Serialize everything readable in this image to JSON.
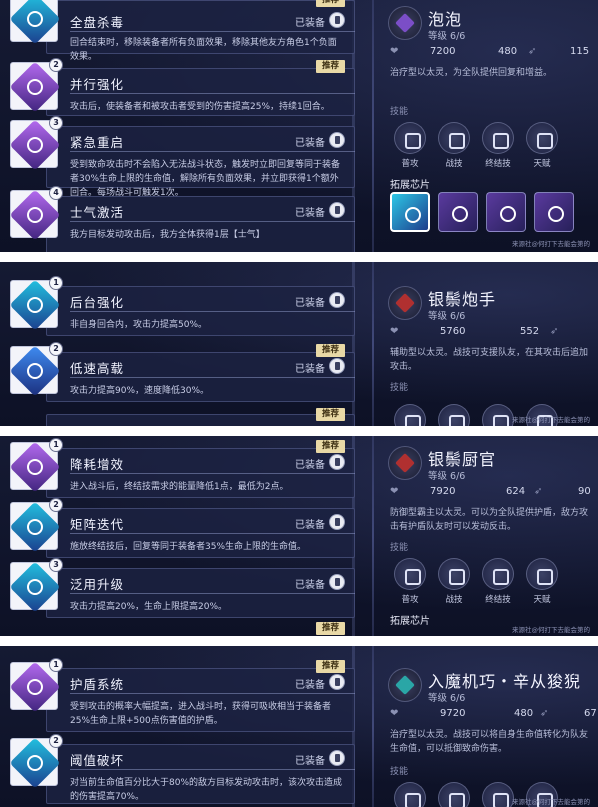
{
  "screens": [
    {
      "chips": [
        {
          "num": "",
          "name": "全盘杀毒",
          "equip": "已装备",
          "tag": "推荐",
          "desc": "回合结束时，移除装备者所有负面效果，移除其他友方角色1个负面效果。",
          "color": "teal"
        },
        {
          "num": "2",
          "name": "并行强化",
          "equip": "",
          "tag": "推荐",
          "desc": "攻击后，使装备者和被攻击者受到的伤害提高25%，持续1回合。",
          "color": "purple"
        },
        {
          "num": "3",
          "name": "紧急重启",
          "equip": "已装备",
          "tag": "",
          "desc": "受到致命攻击时不会陷入无法战斗状态，触发时立即回复等同于装备者30%生命上限的生命值，解除所有负面效果，并立即获得1个额外回合。每场战斗可触发1次。",
          "color": "purple"
        },
        {
          "num": "4",
          "name": "士气激活",
          "equip": "已装备",
          "tag": "",
          "desc": "我方目标发动攻击后，我方全体获得1层【士气】",
          "color": "purple"
        }
      ],
      "character": {
        "name": "泡泡",
        "level": "等级 6/6",
        "hp": "7200",
        "atk": "480",
        "third_stat": "115",
        "desc": "治疗型以太灵，为全队提供回复和增益。",
        "skills_title": "技能",
        "skills": [
          "普攻",
          "战技",
          "终结技",
          "天赋"
        ],
        "chips_title": "拓展芯片",
        "watermark": "来源社@何打下去能会第的"
      }
    },
    {
      "chips": [
        {
          "num": "1",
          "name": "后台强化",
          "equip": "已装备",
          "tag": "",
          "desc": "非自身回合内，攻击力提高50%。",
          "color": "teal"
        },
        {
          "num": "2",
          "name": "低速高载",
          "equip": "已装备",
          "tag": "推荐",
          "desc": "攻击力提高90%，速度降低30%。",
          "color": "blue"
        }
      ],
      "next_tag": "推荐",
      "character": {
        "name": "银鬃炮手",
        "level": "等级 6/6",
        "hp": "5760",
        "atk": "552",
        "desc": "辅助型以太灵。战技可支援队友，在其攻击后追加攻击。",
        "skills_title": "技能",
        "watermark": "来源社@何打下去能会第的"
      }
    },
    {
      "chips": [
        {
          "num": "1",
          "name": "降耗增效",
          "equip": "已装备",
          "tag": "推荐",
          "desc": "进入战斗后，终结技需求的能量降低1点，最低为2点。",
          "color": "purple"
        },
        {
          "num": "2",
          "name": "矩阵迭代",
          "equip": "已装备",
          "tag": "",
          "desc": "施放终结技后，回复等同于装备者35%生命上限的生命值。",
          "color": "teal"
        },
        {
          "num": "3",
          "name": "泛用升级",
          "equip": "已装备",
          "tag": "",
          "desc": "攻击力提高20%，生命上限提高20%。",
          "color": "teal"
        }
      ],
      "next_tag": "推荐",
      "character": {
        "name": "银鬃厨官",
        "level": "等级 6/6",
        "hp": "7920",
        "atk": "624",
        "third_stat": "90",
        "desc": "防御型霸主以太灵。可以为全队提供护盾，敌方攻击有护盾队友时可以发动反击。",
        "skills_title": "技能",
        "skills": [
          "普攻",
          "战技",
          "终结技",
          "天赋"
        ],
        "chips_title": "拓展芯片",
        "watermark": "来源社@何打下去能会第的"
      }
    },
    {
      "chips": [
        {
          "num": "1",
          "name": "护盾系统",
          "equip": "已装备",
          "tag": "推荐",
          "desc": "受到攻击的概率大幅提高，进入战斗时，获得可吸收相当于装备者25%生命上限+500点伤害值的护盾。",
          "color": "purple"
        },
        {
          "num": "2",
          "name": "阈值破坏",
          "equip": "已装备",
          "tag": "",
          "desc": "对当前生命值百分比大于80%的敌方目标发动攻击时，该次攻击造成的伤害提高70%。",
          "color": "teal"
        }
      ],
      "character": {
        "name": "入魔机巧・辛从狻猊",
        "level": "等级 6/6",
        "hp": "9720",
        "atk": "480",
        "third_stat": "67",
        "desc": "治疗型以太灵。战技可以将自身生命值转化为队友生命值，可以抵御致命伤害。",
        "skills_title": "技能",
        "watermark": "来源社@何打下去能会第的"
      }
    }
  ]
}
